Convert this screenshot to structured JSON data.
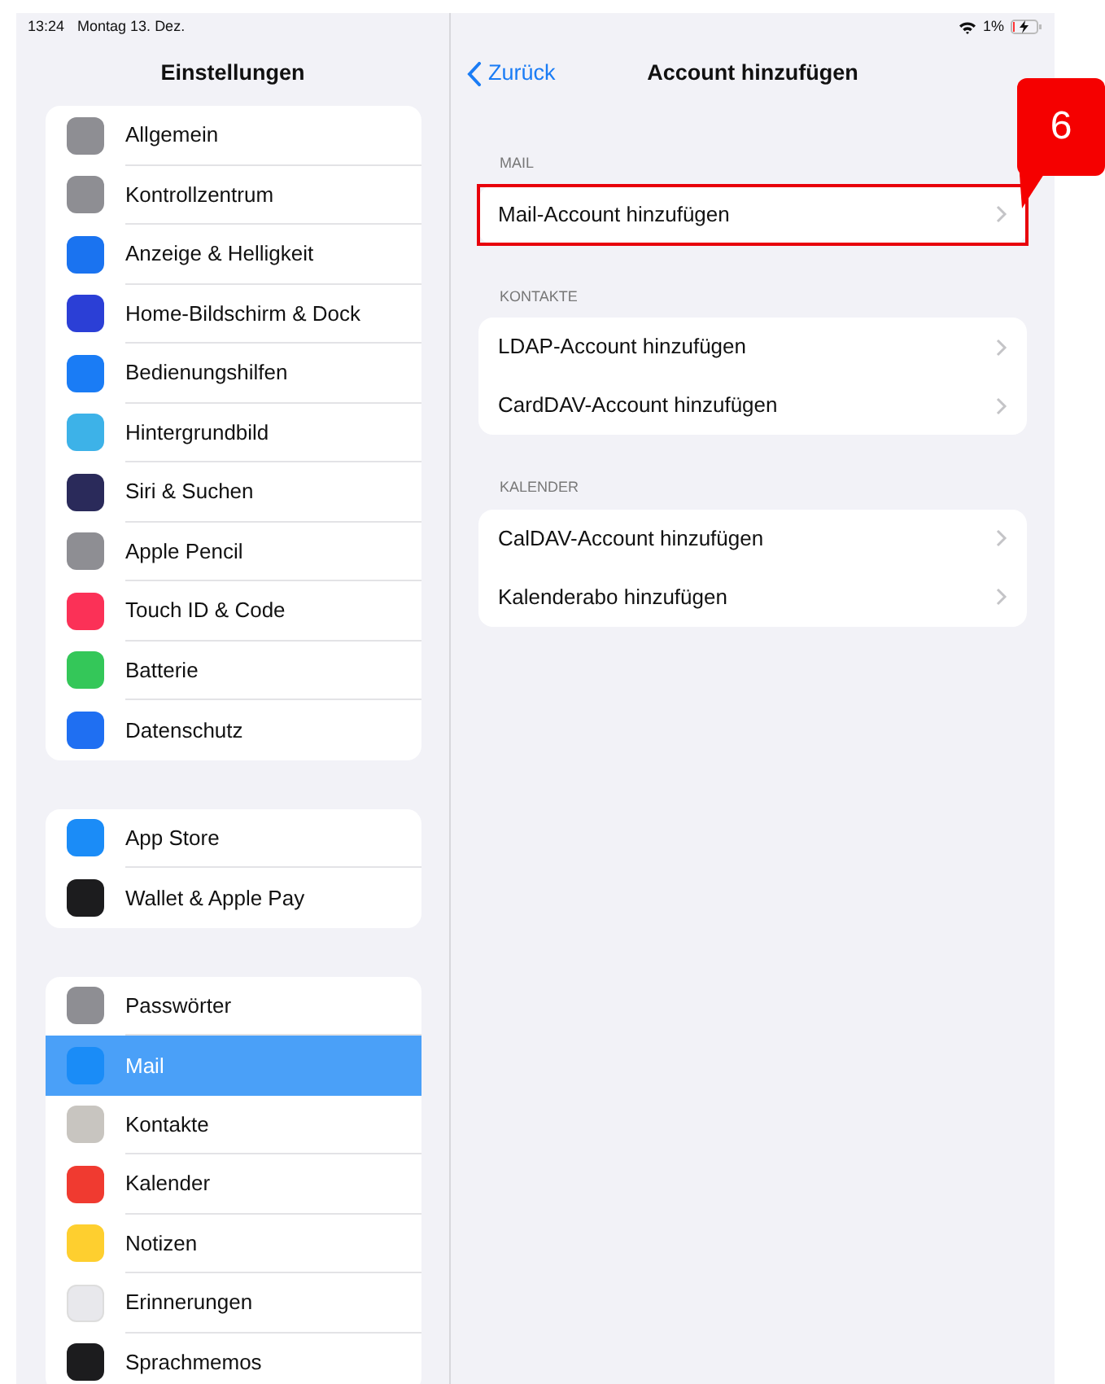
{
  "status_bar": {
    "time": "13:24",
    "date": "Montag 13. Dez.",
    "battery": "1%"
  },
  "sidebar": {
    "title": "Einstellungen",
    "groups": [
      {
        "items": [
          {
            "label": "Allgemein",
            "color": "#8e8e93",
            "selected": false
          },
          {
            "label": "Kontrollzentrum",
            "color": "#8e8e93",
            "selected": false
          },
          {
            "label": "Anzeige & Helligkeit",
            "color": "#1a73f0",
            "selected": false
          },
          {
            "label": "Home-Bildschirm & Dock",
            "color": "#2b3fd6",
            "selected": false
          },
          {
            "label": "Bedienungshilfen",
            "color": "#1a7cf5",
            "selected": false
          },
          {
            "label": "Hintergrundbild",
            "color": "#3db2e8",
            "selected": false
          },
          {
            "label": "Siri & Suchen",
            "color": "#2a2a5a",
            "selected": false
          },
          {
            "label": "Apple Pencil",
            "color": "#8e8e93",
            "selected": false
          },
          {
            "label": "Touch ID & Code",
            "color": "#fb3157",
            "selected": false
          },
          {
            "label": "Batterie",
            "color": "#34c759",
            "selected": false
          },
          {
            "label": "Datenschutz",
            "color": "#1f6ff2",
            "selected": false
          }
        ]
      },
      {
        "items": [
          {
            "label": "App Store",
            "color": "#1b8cf7",
            "selected": false
          },
          {
            "label": "Wallet & Apple Pay",
            "color": "#1c1c1e",
            "selected": false
          }
        ]
      },
      {
        "items": [
          {
            "label": "Passwörter",
            "color": "#8e8e93",
            "selected": false
          },
          {
            "label": "Mail",
            "color": "#1a8cf7",
            "selected": true
          },
          {
            "label": "Kontakte",
            "color": "#c8c5c0",
            "selected": false
          },
          {
            "label": "Kalender",
            "color": "#f03a30",
            "selected": false
          },
          {
            "label": "Notizen",
            "color": "#fecf2f",
            "selected": false
          },
          {
            "label": "Erinnerungen",
            "color": "#e8e8ec",
            "selected": false
          },
          {
            "label": "Sprachmemos",
            "color": "#1c1c1e",
            "selected": false
          }
        ]
      }
    ]
  },
  "detail": {
    "back": "Zurück",
    "title": "Account hinzufügen",
    "sections": [
      {
        "header": "MAIL",
        "rows": [
          {
            "label": "Mail-Account hinzufügen",
            "highlighted": true
          }
        ]
      },
      {
        "header": "KONTAKTE",
        "rows": [
          {
            "label": "LDAP-Account hinzufügen",
            "highlighted": false
          },
          {
            "label": "CardDAV-Account hinzufügen",
            "highlighted": false
          }
        ]
      },
      {
        "header": "KALENDER",
        "rows": [
          {
            "label": "CalDAV-Account hinzufügen",
            "highlighted": false
          },
          {
            "label": "Kalenderabo hinzufügen",
            "highlighted": false
          }
        ]
      }
    ]
  },
  "callout": {
    "number": "6"
  }
}
